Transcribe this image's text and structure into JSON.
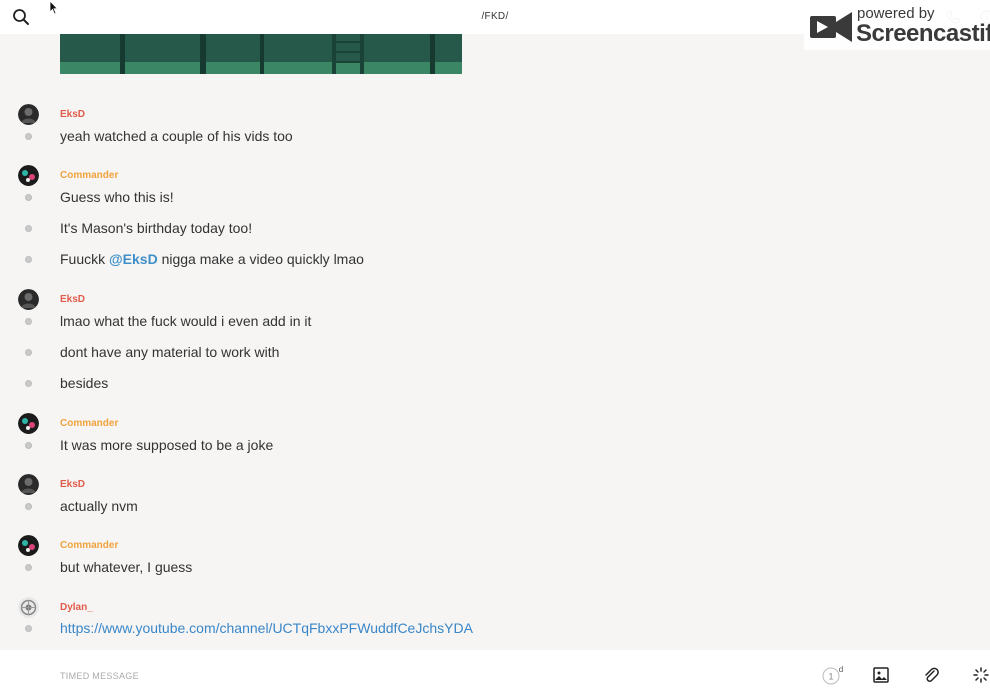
{
  "header": {
    "room_title": "/FKD/"
  },
  "watermark": {
    "small_text": "powered by",
    "brand": "Screencastify"
  },
  "colors": {
    "eksd": "#e15b4a",
    "commander": "#f0a23c",
    "dylan": "#e15b4a",
    "mention": "#3f8fc9",
    "link": "#3a86c8"
  },
  "messages": [
    {
      "author": "EksD",
      "lines": [
        "yeah watched a couple of his vids too"
      ]
    },
    {
      "author": "Commander",
      "lines": [
        "Guess who this is!",
        "It's Mason's birthday today too!"
      ],
      "mention_line": {
        "before": "Fuuckk ",
        "mention": "@EksD",
        "after": " nigga make a video quickly lmao"
      }
    },
    {
      "author": "EksD",
      "lines": [
        "lmao what the fuck would i even add in it",
        "dont have any material to work with",
        "besides"
      ]
    },
    {
      "author": "Commander",
      "lines": [
        "It was more supposed to be a joke"
      ]
    },
    {
      "author": "EksD",
      "lines": [
        "actually nvm"
      ]
    },
    {
      "author": "Commander",
      "lines": [
        "but whatever, I guess"
      ]
    },
    {
      "author": "Dylan_",
      "link": "https://www.youtube.com/channel/UCTqFbxxPFWuddfCeJchsYDA"
    }
  ],
  "composer": {
    "placeholder": "TIMED MESSAGE",
    "timer_value": "1",
    "timer_unit": "d"
  },
  "icons": {
    "search": "search-icon",
    "phone": "phone-icon",
    "info": "info-icon",
    "image": "image-icon",
    "attach": "paperclip-icon",
    "sparkle": "sparkle-icon"
  }
}
